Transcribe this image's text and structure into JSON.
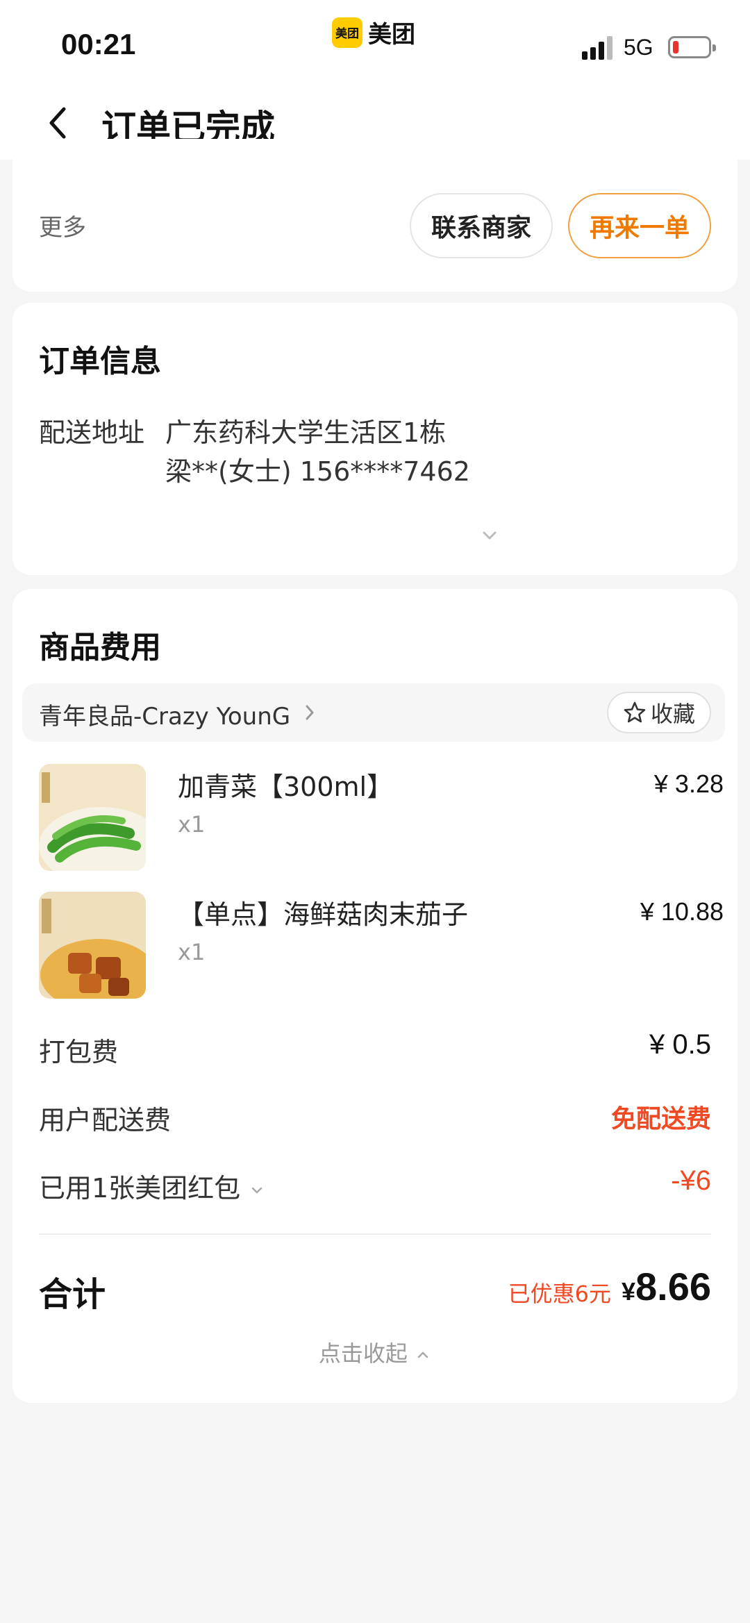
{
  "status_bar": {
    "time": "00:21",
    "app_badge": "美团",
    "app_name": "美团",
    "network": "5G",
    "battery_level": 0.1
  },
  "nav": {
    "title": "订单已完成"
  },
  "actions": {
    "more_label": "更多",
    "contact_label": "联系商家",
    "reorder_label": "再来一单"
  },
  "order_info": {
    "title": "订单信息",
    "address_label": "配送地址",
    "address_line1": "广东药科大学生活区1栋",
    "address_line2": "梁**(女士) 156****7462"
  },
  "goods": {
    "title": "商品费用",
    "shop_name": "青年良品-Crazy YounG",
    "favorite_label": "收藏",
    "items": [
      {
        "name": "加青菜【300ml】",
        "qty": "x1",
        "price": "¥ 3.28"
      },
      {
        "name": "【单点】海鲜菇肉末茄子",
        "qty": "x1",
        "price": "¥ 10.88"
      }
    ],
    "packing_fee_label": "打包费",
    "packing_fee_value": "¥ 0.5",
    "delivery_fee_label": "用户配送费",
    "delivery_fee_value": "免配送费",
    "coupon_label": "已用1张美团红包",
    "coupon_value": "-¥6",
    "total_label": "合计",
    "saved_label": "已优惠6元",
    "total_currency": "¥",
    "total_value": "8.66",
    "collapse_label": "点击收起"
  },
  "colors": {
    "accent_orange": "#f07a00",
    "discount_red": "#f04a24",
    "brand_yellow": "#ffcc00"
  }
}
